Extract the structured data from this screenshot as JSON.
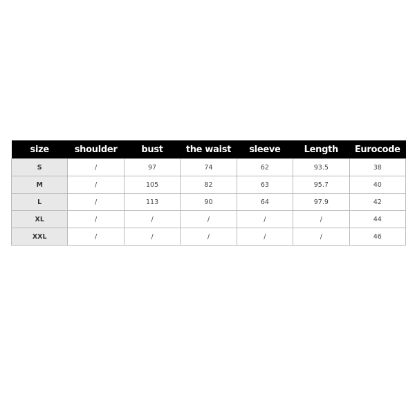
{
  "table": {
    "headers": [
      "size",
      "shoulder",
      "bust",
      "the waist",
      "sleeve",
      "Length",
      "Eurocode"
    ],
    "rows": [
      [
        "S",
        "/",
        "97",
        "74",
        "62",
        "93.5",
        "38"
      ],
      [
        "M",
        "/",
        "105",
        "82",
        "63",
        "95.7",
        "40"
      ],
      [
        "L",
        "/",
        "113",
        "90",
        "64",
        "97.9",
        "42"
      ],
      [
        "XL",
        "/",
        "/",
        "/",
        "/",
        "/",
        "44"
      ],
      [
        "XXL",
        "/",
        "/",
        "/",
        "/",
        "/",
        "46"
      ]
    ]
  },
  "colors": {
    "header_bg": "#000000",
    "header_text": "#ffffff",
    "size_col_bg": "#e8e8e8",
    "border": "#b8b8b8"
  }
}
